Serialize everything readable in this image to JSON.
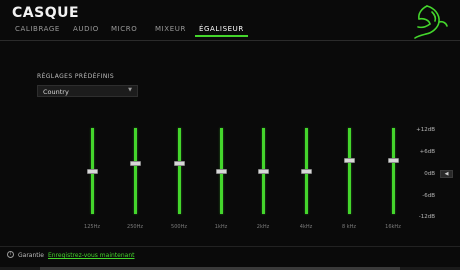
{
  "app": {
    "title": "CASQUE"
  },
  "tabs": [
    {
      "label": "CALIBRAGE",
      "active": false
    },
    {
      "label": "AUDIO",
      "active": false
    },
    {
      "label": "MICRO",
      "active": false
    },
    {
      "label": "MIXEUR",
      "active": false
    },
    {
      "label": "ÉGALISEUR",
      "active": true
    }
  ],
  "presets": {
    "label": "RÉGLAGES PRÉDÉFINIS",
    "selected": "Country"
  },
  "equalizer": {
    "min_db": -12,
    "max_db": 12,
    "db_labels": [
      "+12dB",
      "+6dB",
      "0dB",
      "-6dB",
      "-12dB"
    ],
    "bands": [
      {
        "freq": "125Hz",
        "gain_db": 0
      },
      {
        "freq": "250Hz",
        "gain_db": 2
      },
      {
        "freq": "500Hz",
        "gain_db": 2
      },
      {
        "freq": "1kHz",
        "gain_db": 0
      },
      {
        "freq": "2kHz",
        "gain_db": 0
      },
      {
        "freq": "4kHz",
        "gain_db": 0
      },
      {
        "freq": "8 kHz",
        "gain_db": 3
      },
      {
        "freq": "16kHz",
        "gain_db": 3
      }
    ],
    "reset_icon": "left-arrow-icon"
  },
  "footer": {
    "warranty_label": "Garantie",
    "register_link": "Enregistrez-vous maintenant"
  },
  "colors": {
    "accent": "#44d62c",
    "background": "#0a0a0a"
  }
}
